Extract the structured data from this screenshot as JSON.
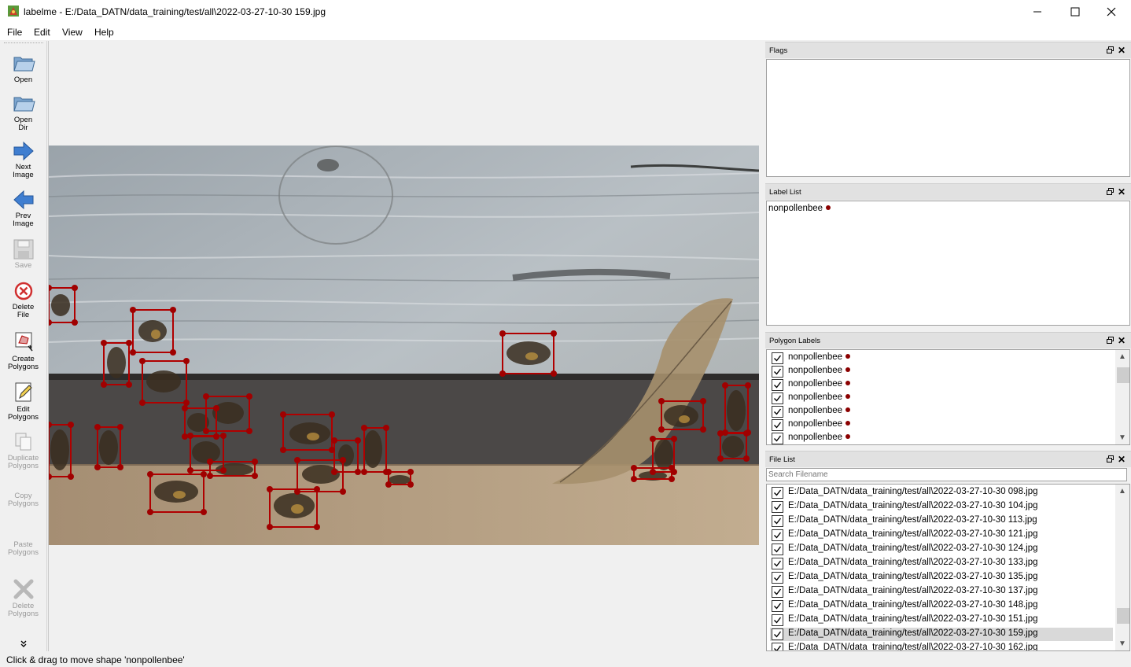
{
  "window": {
    "title": "labelme - E:/Data_DATN/data_training/test/all\\2022-03-27-10-30 159.jpg"
  },
  "menu": [
    "File",
    "Edit",
    "View",
    "Help"
  ],
  "toolbar": {
    "open": [
      "Open"
    ],
    "open_dir": [
      "Open",
      "Dir"
    ],
    "next_image": [
      "Next",
      "Image"
    ],
    "prev_image": [
      "Prev",
      "Image"
    ],
    "save": [
      "Save"
    ],
    "delete_file": [
      "Delete",
      "File"
    ],
    "create_polygons": [
      "Create",
      "Polygons"
    ],
    "edit_polygons": [
      "Edit",
      "Polygons"
    ],
    "duplicate_polygons": [
      "Duplicate",
      "Polygons"
    ],
    "copy_polygons": [
      "Copy",
      "Polygons"
    ],
    "paste_polygons": [
      "Paste",
      "Polygons"
    ],
    "delete_polygons": [
      "Delete",
      "Polygons"
    ]
  },
  "panels": {
    "flags": {
      "title": "Flags"
    },
    "label_list": {
      "title": "Label List",
      "items": [
        "nonpollenbee"
      ]
    },
    "polygon_labels": {
      "title": "Polygon Labels",
      "items": [
        "nonpollenbee",
        "nonpollenbee",
        "nonpollenbee",
        "nonpollenbee",
        "nonpollenbee",
        "nonpollenbee",
        "nonpollenbee"
      ]
    },
    "file_list": {
      "title": "File List",
      "search_placeholder": "Search Filename",
      "items": [
        "E:/Data_DATN/data_training/test/all\\2022-03-27-10-30 098.jpg",
        "E:/Data_DATN/data_training/test/all\\2022-03-27-10-30 104.jpg",
        "E:/Data_DATN/data_training/test/all\\2022-03-27-10-30 113.jpg",
        "E:/Data_DATN/data_training/test/all\\2022-03-27-10-30 121.jpg",
        "E:/Data_DATN/data_training/test/all\\2022-03-27-10-30 124.jpg",
        "E:/Data_DATN/data_training/test/all\\2022-03-27-10-30 133.jpg",
        "E:/Data_DATN/data_training/test/all\\2022-03-27-10-30 135.jpg",
        "E:/Data_DATN/data_training/test/all\\2022-03-27-10-30 137.jpg",
        "E:/Data_DATN/data_training/test/all\\2022-03-27-10-30 148.jpg",
        "E:/Data_DATN/data_training/test/all\\2022-03-27-10-30 151.jpg",
        "E:/Data_DATN/data_training/test/all\\2022-03-27-10-30 159.jpg",
        "E:/Data_DATN/data_training/test/all\\2022-03-27-10-30 162.jpg"
      ],
      "selected_index": 10
    }
  },
  "status": "Click & drag to move shape 'nonpollenbee'",
  "colors": {
    "label_color": "#8b0000",
    "box_color": "#b00000"
  }
}
